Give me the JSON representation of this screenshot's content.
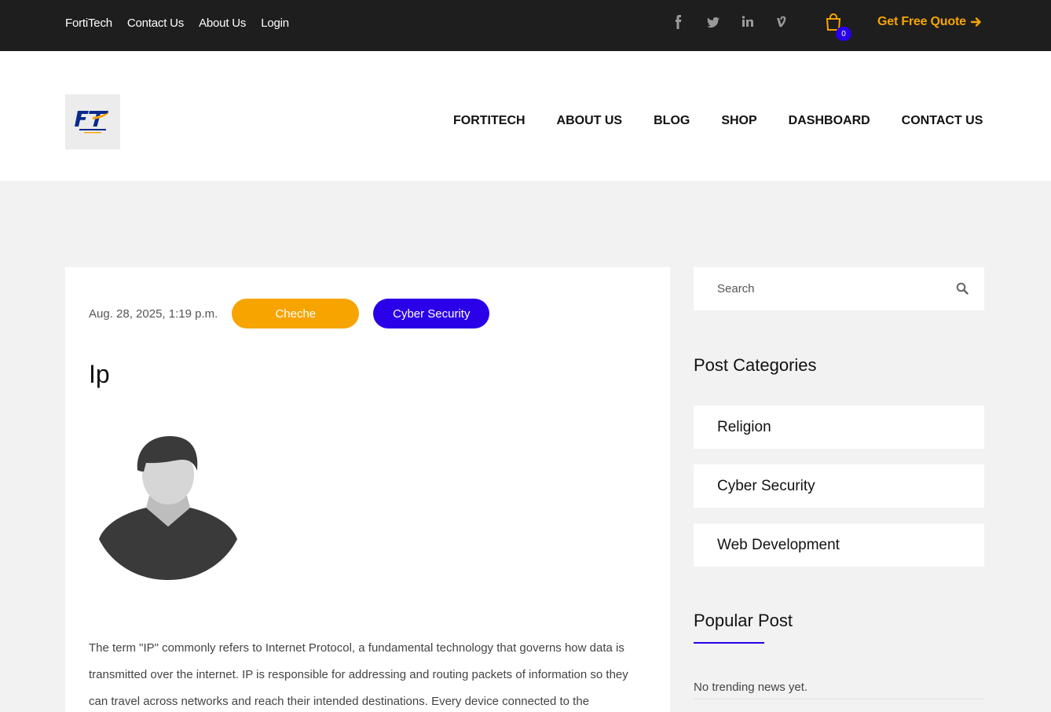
{
  "topbar": {
    "links": [
      "FortiTech",
      "Contact Us",
      "About Us",
      "Login"
    ],
    "cart_count": "0",
    "quote_label": "Get Free Quote",
    "accent_color": "#f7a400"
  },
  "header": {
    "logo_alt": "FT",
    "nav": [
      "FORTITECH",
      "ABOUT US",
      "BLOG",
      "SHOP",
      "DASHBOARD",
      "CONTACT US"
    ]
  },
  "post": {
    "date": "Aug. 28, 2025, 1:19 p.m.",
    "author_tag": "Cheche",
    "category_tag": "Cyber Security",
    "title": "Ip",
    "body": "The term \"IP\" commonly refers to Internet Protocol, a fundamental technology that governs how data is transmitted over the internet. IP is responsible for addressing and routing packets of information so they can travel across networks and reach their intended destinations. Every device connected to the"
  },
  "sidebar": {
    "search_placeholder": "Search",
    "categories_heading": "Post Categories",
    "categories": [
      "Religion",
      "Cyber Security",
      "Web Development"
    ],
    "popular_heading": "Popular Post",
    "no_news": "No trending news yet."
  },
  "colors": {
    "brand_blue": "#2a00e8",
    "brand_orange": "#f7a400",
    "topbar_bg": "#1e1e1e"
  }
}
